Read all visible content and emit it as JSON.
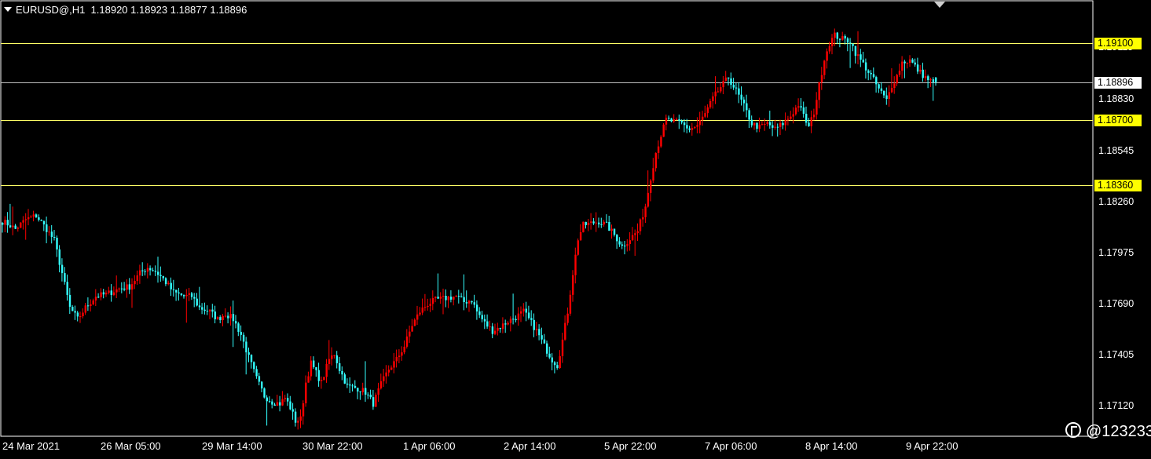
{
  "window": {
    "symbol_line": "EURUSD@,H1  1.18920 1.18923 1.18877 1.18896"
  },
  "colors": {
    "background": "#000000",
    "bull_candle": "#ff0000",
    "bear_candle": "#33ffff",
    "grid_line": "#ffffff",
    "level_line": "#ffff66",
    "level_tag": "#ffff00",
    "current_price_line": "#c0c0c0"
  },
  "price_axis": {
    "ticks": [
      "1.19115",
      "1.18830",
      "1.18545",
      "1.18260",
      "1.17975",
      "1.17690",
      "1.17405",
      "1.17120"
    ]
  },
  "levels": [
    {
      "label": "1.19100",
      "price": 1.191
    },
    {
      "label": "1.18700",
      "price": 1.187
    },
    {
      "label": "1.18360",
      "price": 1.1836
    }
  ],
  "current_price": {
    "label": "1.18896",
    "price": 1.18896
  },
  "time_axis": {
    "labels": [
      "24 Mar 2021",
      "26 Mar 05:00",
      "29 Mar 14:00",
      "30 Mar 22:00",
      "1 Apr 06:00",
      "2 Apr 14:00",
      "5 Apr 22:00",
      "7 Apr 06:00",
      "8 Apr 14:00",
      "9 Apr 22:00"
    ]
  },
  "watermark": {
    "text": "@123233"
  },
  "chart_data": {
    "type": "candlestick",
    "instrument": "EURUSD@",
    "timeframe": "H1",
    "last_bar": {
      "open": 1.1892,
      "high": 1.18923,
      "low": 1.18877,
      "close": 1.18896
    },
    "ylim": [
      1.1705,
      1.1932
    ],
    "note_x": "hourly bars from 24 Mar 2021 to 9 Apr 2021",
    "close_path": [
      [
        0,
        1.1817
      ],
      [
        3,
        1.1815
      ],
      [
        5,
        1.1813
      ],
      [
        9,
        1.1818
      ],
      [
        13,
        1.182
      ],
      [
        17,
        1.1813
      ],
      [
        20,
        1.1807
      ],
      [
        23,
        1.179
      ],
      [
        26,
        1.1772
      ],
      [
        29,
        1.1766
      ],
      [
        32,
        1.1772
      ],
      [
        36,
        1.1778
      ],
      [
        40,
        1.1779
      ],
      [
        45,
        1.1782
      ],
      [
        49,
        1.1783
      ],
      [
        53,
        1.179
      ],
      [
        56,
        1.1793
      ],
      [
        59,
        1.1791
      ],
      [
        62,
        1.1787
      ],
      [
        66,
        1.178
      ],
      [
        70,
        1.1778
      ],
      [
        73,
        1.1778
      ],
      [
        76,
        1.1772
      ],
      [
        80,
        1.177
      ],
      [
        83,
        1.1766
      ],
      [
        86,
        1.1769
      ],
      [
        89,
        1.1766
      ],
      [
        92,
        1.1758
      ],
      [
        95,
        1.1746
      ],
      [
        98,
        1.1735
      ],
      [
        101,
        1.1726
      ],
      [
        104,
        1.1723
      ],
      [
        107,
        1.1722
      ],
      [
        109,
        1.1725
      ],
      [
        111,
        1.172
      ],
      [
        113,
        1.1713
      ],
      [
        115,
        1.1714
      ],
      [
        117,
        1.1733
      ],
      [
        119,
        1.1743
      ],
      [
        121,
        1.1738
      ],
      [
        123,
        1.1733
      ],
      [
        126,
        1.1745
      ],
      [
        128,
        1.1748
      ],
      [
        130,
        1.174
      ],
      [
        133,
        1.1731
      ],
      [
        137,
        1.173
      ],
      [
        140,
        1.1728
      ],
      [
        143,
        1.1722
      ],
      [
        146,
        1.1732
      ],
      [
        149,
        1.174
      ],
      [
        152,
        1.1745
      ],
      [
        155,
        1.1752
      ],
      [
        158,
        1.1763
      ],
      [
        161,
        1.177
      ],
      [
        164,
        1.1774
      ],
      [
        167,
        1.1776
      ],
      [
        171,
        1.1777
      ],
      [
        175,
        1.1778
      ],
      [
        178,
        1.1775
      ],
      [
        181,
        1.1776
      ],
      [
        183,
        1.177
      ],
      [
        186,
        1.1764
      ],
      [
        189,
        1.176
      ],
      [
        192,
        1.1762
      ],
      [
        195,
        1.1765
      ],
      [
        198,
        1.1767
      ],
      [
        201,
        1.177
      ],
      [
        203,
        1.1766
      ],
      [
        206,
        1.176
      ],
      [
        209,
        1.1752
      ],
      [
        212,
        1.1745
      ],
      [
        214,
        1.1742
      ],
      [
        216,
        1.1755
      ],
      [
        218,
        1.177
      ],
      [
        220,
        1.179
      ],
      [
        222,
        1.1808
      ],
      [
        224,
        1.1815
      ],
      [
        227,
        1.1816
      ],
      [
        230,
        1.1817
      ],
      [
        233,
        1.1815
      ],
      [
        236,
        1.181
      ],
      [
        239,
        1.1804
      ],
      [
        242,
        1.1808
      ],
      [
        245,
        1.1812
      ],
      [
        248,
        1.1825
      ],
      [
        250,
        1.184
      ],
      [
        252,
        1.1853
      ],
      [
        254,
        1.1862
      ],
      [
        256,
        1.187
      ],
      [
        259,
        1.1869
      ],
      [
        262,
        1.1868
      ],
      [
        265,
        1.1865
      ],
      [
        268,
        1.1867
      ],
      [
        271,
        1.1873
      ],
      [
        274,
        1.1881
      ],
      [
        277,
        1.1887
      ],
      [
        280,
        1.1892
      ],
      [
        283,
        1.1885
      ],
      [
        286,
        1.1877
      ],
      [
        289,
        1.1868
      ],
      [
        292,
        1.1866
      ],
      [
        295,
        1.1868
      ],
      [
        298,
        1.1865
      ],
      [
        301,
        1.1868
      ],
      [
        304,
        1.1872
      ],
      [
        307,
        1.1878
      ],
      [
        309,
        1.1872
      ],
      [
        311,
        1.1866
      ],
      [
        313,
        1.1874
      ],
      [
        315,
        1.1888
      ],
      [
        317,
        1.1902
      ],
      [
        319,
        1.191
      ],
      [
        321,
        1.1914
      ],
      [
        324,
        1.1912
      ],
      [
        327,
        1.1911
      ],
      [
        329,
        1.1905
      ],
      [
        332,
        1.1899
      ],
      [
        335,
        1.1893
      ],
      [
        338,
        1.1886
      ],
      [
        341,
        1.188
      ],
      [
        343,
        1.1888
      ],
      [
        345,
        1.1893
      ],
      [
        347,
        1.19
      ],
      [
        350,
        1.1901
      ],
      [
        353,
        1.1896
      ],
      [
        356,
        1.1892
      ],
      [
        359,
        1.1889
      ],
      [
        360,
        1.18896
      ]
    ]
  }
}
